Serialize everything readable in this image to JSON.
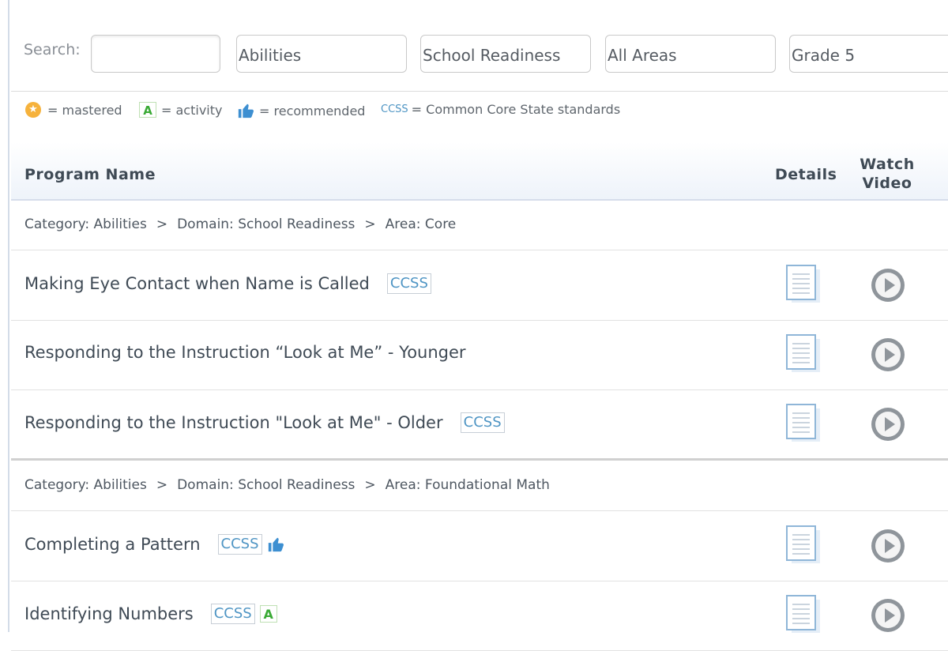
{
  "filters": {
    "search_label": "Search:",
    "search_value": "",
    "selects": [
      "Abilities",
      "School Readiness",
      "All Areas",
      "Grade 5"
    ]
  },
  "legend": {
    "mastered": "= mastered",
    "activity": "= activity",
    "recommended": "= recommended",
    "ccss_word": "CCSS",
    "ccss_text": "= Common Core State standards",
    "activity_letter": "A"
  },
  "table_header": {
    "program_name": "Program Name",
    "details": "Details",
    "watch_video_line1": "Watch",
    "watch_video_line2": "Video"
  },
  "groups": [
    {
      "category": "Category: Abilities",
      "domain": "Domain: School Readiness",
      "area": "Area: Core",
      "programs": [
        {
          "name": "Making Eye Contact when Name is Called",
          "ccss": "CCSS"
        },
        {
          "name": "Responding to the Instruction “Look at Me” - Younger"
        },
        {
          "name": "Responding to the Instruction \"Look at Me\" - Older",
          "ccss": "CCSS"
        }
      ]
    },
    {
      "category": "Category: Abilities",
      "domain": "Domain: School Readiness",
      "area": "Area: Foundational Math",
      "programs": [
        {
          "name": "Completing a Pattern",
          "ccss": "CCSS",
          "recommended": true
        },
        {
          "name": "Identifying Numbers",
          "ccss": "CCSS",
          "activity": "A"
        }
      ]
    }
  ],
  "breadcrumb_separator": ">",
  "colors": {
    "accent_blue": "#4f95c4",
    "star_orange": "#f6b23c",
    "activity_green": "#3aaa35",
    "play_gray": "#8f959b"
  }
}
